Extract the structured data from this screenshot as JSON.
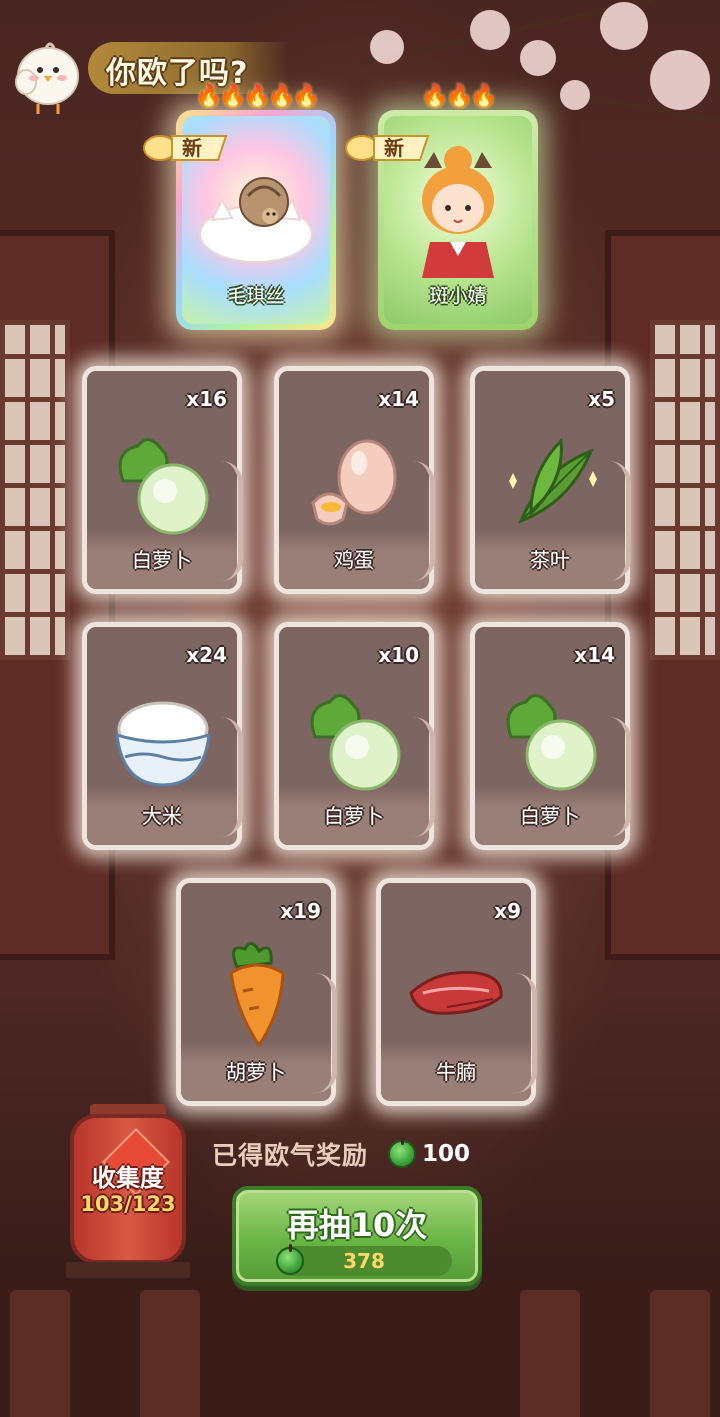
{
  "header": {
    "title": "你欧了吗?"
  },
  "new_characters": [
    {
      "name": "毛琪丝",
      "badge": "新",
      "stars": 5,
      "rarity_color": "rainbow"
    },
    {
      "name": "斑小婧",
      "badge": "新",
      "stars": 3,
      "rarity_color": "#9ed46f"
    }
  ],
  "items": [
    {
      "name": "白萝卜",
      "count": "x16",
      "icon": "white-radish-icon"
    },
    {
      "name": "鸡蛋",
      "count": "x14",
      "icon": "egg-icon"
    },
    {
      "name": "茶叶",
      "count": "x5",
      "icon": "tea-leaf-icon"
    },
    {
      "name": "大米",
      "count": "x24",
      "icon": "rice-bowl-icon"
    },
    {
      "name": "白萝卜",
      "count": "x10",
      "icon": "white-radish-icon"
    },
    {
      "name": "白萝卜",
      "count": "x14",
      "icon": "white-radish-icon"
    },
    {
      "name": "胡萝卜",
      "count": "x19",
      "icon": "carrot-icon"
    },
    {
      "name": "牛腩",
      "count": "x9",
      "icon": "beef-brisket-icon"
    }
  ],
  "collection": {
    "label": "收集度",
    "progress": "103/123"
  },
  "reward": {
    "label": "已得欧气奖励",
    "value": "100",
    "icon": "green-apple-coin-icon"
  },
  "draw_button": {
    "label": "再抽10次",
    "cost": "378",
    "icon": "green-apple-coin-icon"
  },
  "colors": {
    "button_green": "#6ab546",
    "card_bg": "#7d6561",
    "gold_text": "#ffd66a"
  }
}
